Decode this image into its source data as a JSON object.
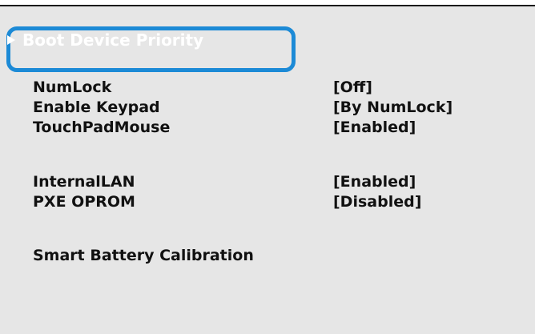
{
  "boot_device_priority": {
    "label": "Boot Device Priority"
  },
  "settings": [
    {
      "label": "NumLock",
      "value": "[Off]"
    },
    {
      "label": "Enable Keypad",
      "value": "[By NumLock]"
    },
    {
      "label": "TouchPadMouse",
      "value": "[Enabled]"
    },
    {
      "label": "InternalLAN",
      "value": "[Enabled]"
    },
    {
      "label": "PXE OPROM",
      "value": "[Disabled]"
    },
    {
      "label": "Smart Battery Calibration",
      "value": ""
    }
  ],
  "colors": {
    "panel_background": "#e6e6e6",
    "highlight_border": "#1c8ad6",
    "text": "#111111",
    "selected_text": "#ffffff"
  }
}
